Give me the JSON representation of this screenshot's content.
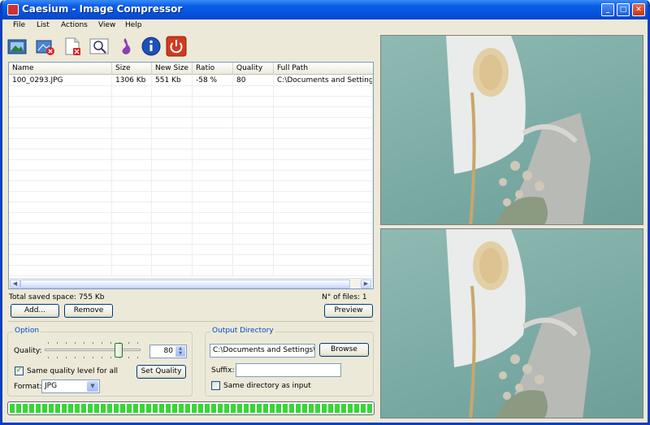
{
  "window": {
    "title": "Caesium - Image Compressor",
    "min": "_",
    "max": "□",
    "close": "✕"
  },
  "menu": [
    "File",
    "List",
    "Actions",
    "View",
    "Help"
  ],
  "toolbar_icons": [
    "open-images-icon",
    "remove-image-icon",
    "clear-list-icon",
    "preview-icon",
    "compress-icon",
    "info-icon",
    "exit-icon"
  ],
  "list": {
    "columns": [
      "Name",
      "Size",
      "New Size",
      "Ratio",
      "Quality",
      "Full Path"
    ],
    "rows": [
      [
        "100_0293.JPG",
        "1306 Kb",
        "551 Kb",
        "-58 %",
        "80",
        "C:\\Documents and Settings\\u"
      ]
    ]
  },
  "status": {
    "saved": "Total saved space: 755 Kb",
    "files": "N° of files: 1"
  },
  "buttons": {
    "add": "Add...",
    "remove": "Remove",
    "preview": "Preview",
    "browse": "Browse",
    "set_quality": "Set Quality"
  },
  "option": {
    "title": "Option",
    "quality_label": "Quality:",
    "quality_value": "80",
    "same_quality_label": "Same quality level for all",
    "same_quality_checked": true,
    "format_label": "Format:",
    "format_value": "JPG"
  },
  "output": {
    "title": "Output Directory",
    "path": "C:\\Documents and Settings\\us",
    "suffix_label": "Suffix:",
    "suffix_value": "",
    "same_dir_label": "Same directory as input",
    "same_dir_checked": false
  },
  "progress_fraction": 1.0,
  "colors": {
    "titlebar": "#0652dc",
    "group_title": "#0046d5",
    "progress": "#35d835",
    "preview_bg": "#7aaaa4"
  }
}
